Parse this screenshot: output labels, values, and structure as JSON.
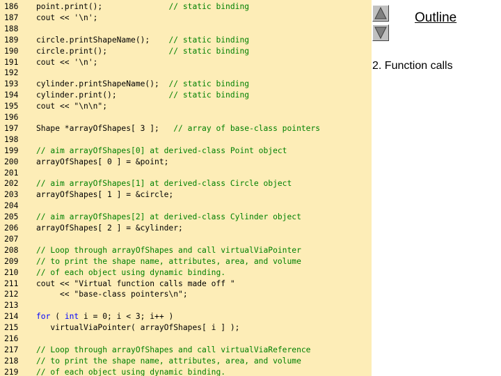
{
  "outline": {
    "title": "Outline",
    "item": "2. Function calls"
  },
  "nav": {
    "up_icon": "triangle-up-icon",
    "down_icon": "triangle-down-icon"
  },
  "colors": {
    "panel_background": "#fdedb7",
    "comment": "#008000",
    "keyword": "#0000ff"
  },
  "lines": [
    {
      "n": "186",
      "segs": [
        {
          "t": "point.print();              ",
          "c": "code"
        },
        {
          "t": "// static binding",
          "c": "comment"
        }
      ]
    },
    {
      "n": "187",
      "segs": [
        {
          "t": "cout << '\\n';",
          "c": "code"
        }
      ]
    },
    {
      "n": "188",
      "segs": []
    },
    {
      "n": "189",
      "segs": [
        {
          "t": "circle.printShapeName();    ",
          "c": "code"
        },
        {
          "t": "// static binding",
          "c": "comment"
        }
      ]
    },
    {
      "n": "190",
      "segs": [
        {
          "t": "circle.print();             ",
          "c": "code"
        },
        {
          "t": "// static binding",
          "c": "comment"
        }
      ]
    },
    {
      "n": "191",
      "segs": [
        {
          "t": "cout << '\\n';",
          "c": "code"
        }
      ]
    },
    {
      "n": "192",
      "segs": []
    },
    {
      "n": "193",
      "segs": [
        {
          "t": "cylinder.printShapeName();  ",
          "c": "code"
        },
        {
          "t": "// static binding",
          "c": "comment"
        }
      ]
    },
    {
      "n": "194",
      "segs": [
        {
          "t": "cylinder.print();           ",
          "c": "code"
        },
        {
          "t": "// static binding",
          "c": "comment"
        }
      ]
    },
    {
      "n": "195",
      "segs": [
        {
          "t": "cout << \"\\n\\n\";",
          "c": "code"
        }
      ]
    },
    {
      "n": "196",
      "segs": []
    },
    {
      "n": "197",
      "segs": [
        {
          "t": "Shape *arrayOfShapes[ 3 ];   ",
          "c": "code"
        },
        {
          "t": "// array of base-class pointers",
          "c": "comment"
        }
      ]
    },
    {
      "n": "198",
      "segs": []
    },
    {
      "n": "199",
      "segs": [
        {
          "t": "// aim arrayOfShapes[0] at derived-class Point object",
          "c": "comment"
        }
      ]
    },
    {
      "n": "200",
      "segs": [
        {
          "t": "arrayOfShapes[ 0 ] = &point;",
          "c": "code"
        }
      ]
    },
    {
      "n": "201",
      "segs": []
    },
    {
      "n": "202",
      "segs": [
        {
          "t": "// aim arrayOfShapes[1] at derived-class Circle object",
          "c": "comment"
        }
      ]
    },
    {
      "n": "203",
      "segs": [
        {
          "t": "arrayOfShapes[ 1 ] = &circle;",
          "c": "code"
        }
      ]
    },
    {
      "n": "204",
      "segs": []
    },
    {
      "n": "205",
      "segs": [
        {
          "t": "// aim arrayOfShapes[2] at derived-class Cylinder object",
          "c": "comment"
        }
      ]
    },
    {
      "n": "206",
      "segs": [
        {
          "t": "arrayOfShapes[ 2 ] = &cylinder;",
          "c": "code"
        }
      ]
    },
    {
      "n": "207",
      "segs": []
    },
    {
      "n": "208",
      "segs": [
        {
          "t": "// Loop through arrayOfShapes and call virtualViaPointer",
          "c": "comment"
        }
      ]
    },
    {
      "n": "209",
      "segs": [
        {
          "t": "// to print the shape name, attributes, area, and volume",
          "c": "comment"
        }
      ]
    },
    {
      "n": "210",
      "segs": [
        {
          "t": "// of each object using dynamic binding.",
          "c": "comment"
        }
      ]
    },
    {
      "n": "211",
      "segs": [
        {
          "t": "cout << \"Virtual function calls made off \"",
          "c": "code"
        }
      ]
    },
    {
      "n": "212",
      "segs": [
        {
          "t": "     << \"base-class pointers\\n\";",
          "c": "code"
        }
      ]
    },
    {
      "n": "213",
      "segs": []
    },
    {
      "n": "214",
      "segs": [
        {
          "t": "for",
          "c": "kw"
        },
        {
          "t": " ( ",
          "c": "code"
        },
        {
          "t": "int",
          "c": "kw"
        },
        {
          "t": " i = 0; i < 3; i++ )",
          "c": "code"
        }
      ]
    },
    {
      "n": "215",
      "segs": [
        {
          "t": "   virtualViaPointer( arrayOfShapes[ i ] );",
          "c": "code"
        }
      ]
    },
    {
      "n": "216",
      "segs": []
    },
    {
      "n": "217",
      "segs": [
        {
          "t": "// Loop through arrayOfShapes and call virtualViaReference",
          "c": "comment"
        }
      ]
    },
    {
      "n": "218",
      "segs": [
        {
          "t": "// to print the shape name, attributes, area, and volume",
          "c": "comment"
        }
      ]
    },
    {
      "n": "219",
      "segs": [
        {
          "t": "// of each object using dynamic binding.",
          "c": "comment"
        }
      ]
    }
  ]
}
